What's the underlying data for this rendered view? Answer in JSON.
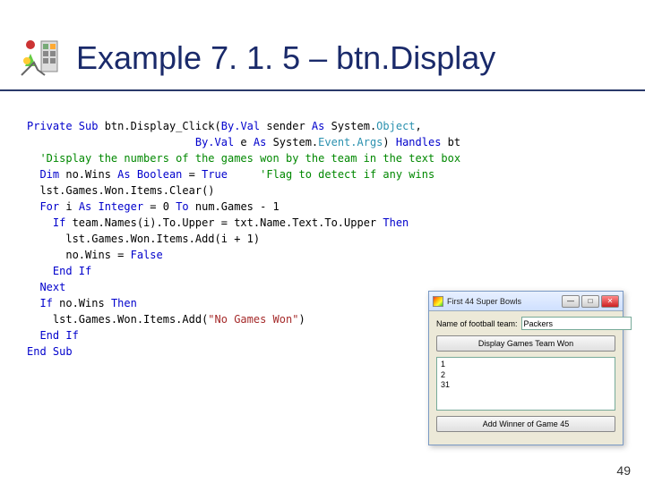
{
  "header": {
    "title": "Example 7. 1. 5 – btn.Display"
  },
  "code": {
    "l1a": "Private Sub",
    "l1b": " btn.Display_Click(",
    "l1c": "By.Val",
    "l1d": " sender ",
    "l1e": "As",
    "l1f": " System.",
    "l1g": "Object",
    "l1h": ",",
    "l2a": "                          ",
    "l2b": "By.Val",
    "l2c": " e ",
    "l2d": "As",
    "l2e": " System.",
    "l2f": "Event.Args",
    "l2g": ") ",
    "l2h": "Handles",
    "l2i": " bt",
    "l3": "  'Display the numbers of the games won by the team in the text box",
    "l4a": "  Dim",
    "l4b": " no.Wins ",
    "l4c": "As Boolean",
    "l4d": " = ",
    "l4e": "True",
    "l4f": "     ",
    "l4g": "'Flag to detect if any wins",
    "l5": "  lst.Games.Won.Items.Clear()",
    "l6a": "  For",
    "l6b": " i ",
    "l6c": "As Integer",
    "l6d": " = 0 ",
    "l6e": "To",
    "l6f": " num.Games - 1",
    "l7a": "    If",
    "l7b": " team.Names(i).To.Upper = txt.Name.Text.To.Upper ",
    "l7c": "Then",
    "l8": "      lst.Games.Won.Items.Add(i + 1)",
    "l9a": "      no.Wins = ",
    "l9b": "False",
    "l10": "    End If",
    "l11": "  Next",
    "l12a": "  If",
    "l12b": " no.Wins ",
    "l12c": "Then",
    "l13a": "    lst.Games.Won.Items.Add(",
    "l13b": "\"No Games Won\"",
    "l13c": ")",
    "l14": "  End If",
    "l15": "End Sub"
  },
  "dialog": {
    "title": "First 44 Super Bowls",
    "label_name": "Name of football team:",
    "input_value": "Packers",
    "btn_display": "Display Games Team Won",
    "list_items": "1\n2\n31",
    "btn_add": "Add Winner of Game 45"
  },
  "page_number": "49"
}
